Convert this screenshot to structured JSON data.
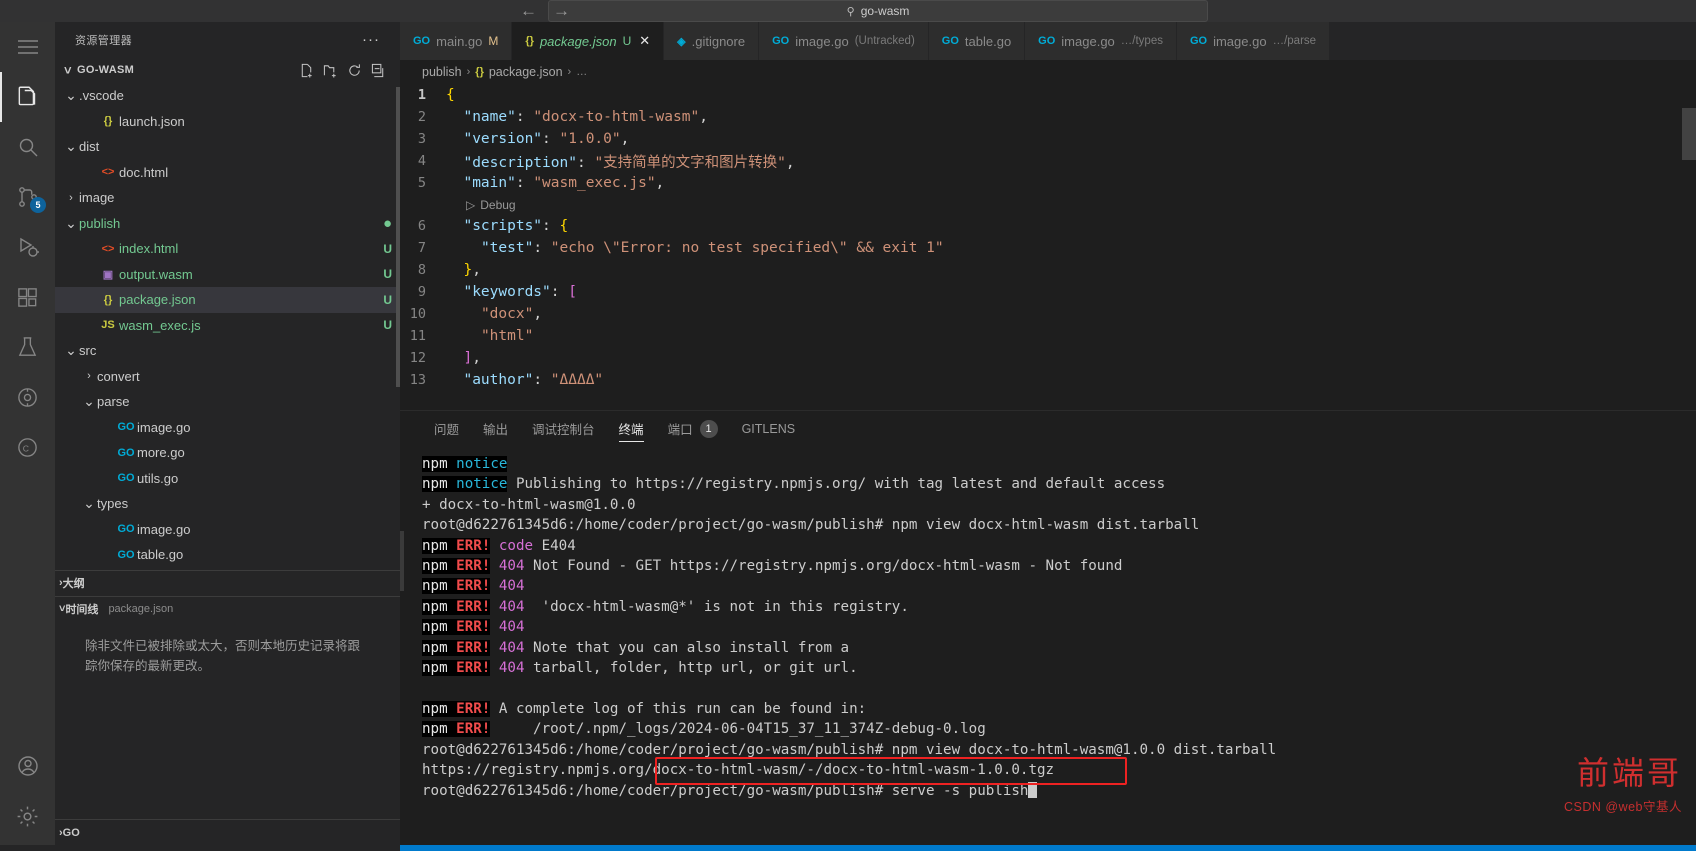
{
  "window": {
    "quick_open_value": "go-wasm",
    "search_icon": "search-icon",
    "back_arrow": "←",
    "forward_arrow": "→"
  },
  "activitybar": {
    "items": [
      {
        "name": "menu-hamburger-icon",
        "label": ""
      },
      {
        "name": "explorer-icon",
        "label": "",
        "active": true
      },
      {
        "name": "search-icon",
        "label": ""
      },
      {
        "name": "source-control-icon",
        "label": "",
        "badge": "5"
      },
      {
        "name": "run-debug-icon",
        "label": ""
      },
      {
        "name": "extensions-icon",
        "label": ""
      },
      {
        "name": "testing-icon",
        "label": ""
      },
      {
        "name": "gitlens-icon",
        "label": ""
      },
      {
        "name": "remote-explorer-icon",
        "label": ""
      }
    ],
    "bottom_items": [
      {
        "name": "accounts-icon",
        "label": ""
      },
      {
        "name": "settings-gear-icon",
        "label": ""
      }
    ]
  },
  "sidebar": {
    "title": "资源管理器",
    "more_actions": "···",
    "root": {
      "label": "GO-WASM",
      "actions": [
        "new-file-icon",
        "new-folder-icon",
        "refresh-icon",
        "collapse-all-icon"
      ]
    },
    "tree": [
      {
        "label": ".vscode",
        "indent": 1,
        "type": "folder",
        "expanded": true,
        "icon": "chevron-down",
        "color": "plain"
      },
      {
        "label": "launch.json",
        "indent": 2,
        "type": "file",
        "icon": "json",
        "color": "plain"
      },
      {
        "label": "dist",
        "indent": 1,
        "type": "folder",
        "expanded": true,
        "icon": "chevron-down",
        "color": "plain"
      },
      {
        "label": "doc.html",
        "indent": 2,
        "type": "file",
        "icon": "html",
        "color": "plain"
      },
      {
        "label": "image",
        "indent": 1,
        "type": "folder",
        "expanded": false,
        "icon": "chevron-right",
        "color": "plain"
      },
      {
        "label": "publish",
        "indent": 1,
        "type": "folder",
        "expanded": true,
        "icon": "chevron-down",
        "color": "green",
        "dot": true
      },
      {
        "label": "index.html",
        "indent": 2,
        "type": "file",
        "icon": "html",
        "color": "green",
        "status": "U"
      },
      {
        "label": "output.wasm",
        "indent": 2,
        "type": "file",
        "icon": "wasm",
        "color": "green",
        "status": "U"
      },
      {
        "label": "package.json",
        "indent": 2,
        "type": "file",
        "icon": "json",
        "color": "green",
        "status": "U",
        "selected": true
      },
      {
        "label": "wasm_exec.js",
        "indent": 2,
        "type": "file",
        "icon": "js",
        "color": "green",
        "status": "U"
      },
      {
        "label": "src",
        "indent": 1,
        "type": "folder",
        "expanded": true,
        "icon": "chevron-down",
        "color": "plain"
      },
      {
        "label": "convert",
        "indent": 2,
        "type": "folder",
        "expanded": false,
        "icon": "chevron-right",
        "color": "plain"
      },
      {
        "label": "parse",
        "indent": 2,
        "type": "folder",
        "expanded": true,
        "icon": "chevron-down",
        "color": "plain"
      },
      {
        "label": "image.go",
        "indent": 3,
        "type": "file",
        "icon": "go",
        "color": "plain"
      },
      {
        "label": "more.go",
        "indent": 3,
        "type": "file",
        "icon": "go",
        "color": "plain"
      },
      {
        "label": "utils.go",
        "indent": 3,
        "type": "file",
        "icon": "go",
        "color": "plain"
      },
      {
        "label": "types",
        "indent": 2,
        "type": "folder",
        "expanded": true,
        "icon": "chevron-down",
        "color": "plain"
      },
      {
        "label": "image.go",
        "indent": 3,
        "type": "file",
        "icon": "go",
        "color": "plain"
      },
      {
        "label": "table.go",
        "indent": 3,
        "type": "file",
        "icon": "go",
        "color": "plain"
      }
    ],
    "outline": {
      "label": "大纲",
      "expanded": false
    },
    "timeline": {
      "label": "时间线",
      "file": "package.json",
      "expanded": true,
      "message": "除非文件已被排除或太大，否则本地历史记录将跟踪你保存的最新更改。"
    },
    "go_section": {
      "label": "GO",
      "expanded": false
    }
  },
  "tabs": [
    {
      "name": "main.go",
      "icon": "go",
      "suffix": "",
      "status": "M",
      "active": false,
      "closable": false
    },
    {
      "name": "package.json",
      "icon": "json",
      "suffix": "",
      "status": "U",
      "active": true,
      "closable": true
    },
    {
      "name": ".gitignore",
      "icon": "git",
      "suffix": "",
      "status": "",
      "active": false,
      "closable": false
    },
    {
      "name": "image.go",
      "icon": "go",
      "suffix": "(Untracked)",
      "status": "",
      "active": false,
      "closable": false
    },
    {
      "name": "table.go",
      "icon": "go",
      "suffix": "",
      "status": "",
      "active": false,
      "closable": false
    },
    {
      "name": "image.go",
      "icon": "go",
      "suffix": "…/types",
      "status": "",
      "active": false,
      "closable": false
    },
    {
      "name": "image.go",
      "icon": "go",
      "suffix": "…/parse",
      "status": "",
      "active": false,
      "closable": false
    }
  ],
  "breadcrumb": {
    "items": [
      "publish",
      "package.json",
      "…"
    ],
    "separator": "›"
  },
  "editor": {
    "codelens": "Debug",
    "codelens_icon": "play-icon",
    "lines": [
      {
        "no": "1",
        "text": "{",
        "current": true
      },
      {
        "no": "2",
        "text": "  \"name\": \"docx-to-html-wasm\","
      },
      {
        "no": "3",
        "text": "  \"version\": \"1.0.0\","
      },
      {
        "no": "4",
        "text": "  \"description\": \"支持简单的文字和图片转换\","
      },
      {
        "no": "5",
        "text": "  \"main\": \"wasm_exec.js\","
      },
      {
        "no": "6",
        "text": "  \"scripts\": {"
      },
      {
        "no": "7",
        "text": "    \"test\": \"echo \\\"Error: no test specified\\\" && exit 1\""
      },
      {
        "no": "8",
        "text": "  },"
      },
      {
        "no": "9",
        "text": "  \"keywords\": ["
      },
      {
        "no": "10",
        "text": "    \"docx\","
      },
      {
        "no": "11",
        "text": "    \"html\""
      },
      {
        "no": "12",
        "text": "  ],"
      },
      {
        "no": "13",
        "text": "  \"author\": \"ΔΔΔΔ\""
      }
    ]
  },
  "panel": {
    "tabs": [
      {
        "label": "问题",
        "active": false
      },
      {
        "label": "输出",
        "active": false
      },
      {
        "label": "调试控制台",
        "active": false
      },
      {
        "label": "终端",
        "active": true
      },
      {
        "label": "端口",
        "active": false,
        "badge": "1"
      },
      {
        "label": "GITLENS",
        "active": false
      }
    ],
    "terminal_lines": [
      {
        "parts": [
          {
            "t": "npm ",
            "c": "npm"
          },
          {
            "t": "notice",
            "c": "notice"
          }
        ]
      },
      {
        "parts": [
          {
            "t": "npm ",
            "c": "npm"
          },
          {
            "t": "notice",
            "c": "notice"
          },
          {
            "t": " Publishing to https://registry.npmjs.org/ with tag latest and default access",
            "c": "white"
          }
        ]
      },
      {
        "parts": [
          {
            "t": "+ docx-to-html-wasm@1.0.0",
            "c": "white"
          }
        ]
      },
      {
        "parts": [
          {
            "t": "root@d622761345d6:/home/coder/project/go-wasm/publish# npm view docx-html-wasm dist.tarball",
            "c": "white"
          }
        ]
      },
      {
        "parts": [
          {
            "t": "npm ",
            "c": "npm"
          },
          {
            "t": "ERR!",
            "c": "err"
          },
          {
            "t": " ",
            "c": "white"
          },
          {
            "t": "code",
            "c": "code"
          },
          {
            "t": " E404",
            "c": "white"
          }
        ]
      },
      {
        "parts": [
          {
            "t": "npm ",
            "c": "npm"
          },
          {
            "t": "ERR!",
            "c": "err"
          },
          {
            "t": " ",
            "c": "white"
          },
          {
            "t": "404",
            "c": "code"
          },
          {
            "t": " Not Found - GET https://registry.npmjs.org/docx-html-wasm - Not found",
            "c": "white"
          }
        ]
      },
      {
        "parts": [
          {
            "t": "npm ",
            "c": "npm"
          },
          {
            "t": "ERR!",
            "c": "err"
          },
          {
            "t": " ",
            "c": "white"
          },
          {
            "t": "404",
            "c": "code"
          }
        ]
      },
      {
        "parts": [
          {
            "t": "npm ",
            "c": "npm"
          },
          {
            "t": "ERR!",
            "c": "err"
          },
          {
            "t": " ",
            "c": "white"
          },
          {
            "t": "404",
            "c": "code"
          },
          {
            "t": "  'docx-html-wasm@*' is not in this registry.",
            "c": "white"
          }
        ]
      },
      {
        "parts": [
          {
            "t": "npm ",
            "c": "npm"
          },
          {
            "t": "ERR!",
            "c": "err"
          },
          {
            "t": " ",
            "c": "white"
          },
          {
            "t": "404",
            "c": "code"
          }
        ]
      },
      {
        "parts": [
          {
            "t": "npm ",
            "c": "npm"
          },
          {
            "t": "ERR!",
            "c": "err"
          },
          {
            "t": " ",
            "c": "white"
          },
          {
            "t": "404",
            "c": "code"
          },
          {
            "t": " Note that you can also install from a",
            "c": "white"
          }
        ]
      },
      {
        "parts": [
          {
            "t": "npm ",
            "c": "npm"
          },
          {
            "t": "ERR!",
            "c": "err"
          },
          {
            "t": " ",
            "c": "white"
          },
          {
            "t": "404",
            "c": "code"
          },
          {
            "t": " tarball, folder, http url, or git url.",
            "c": "white"
          }
        ]
      },
      {
        "parts": []
      },
      {
        "parts": [
          {
            "t": "npm ",
            "c": "npm"
          },
          {
            "t": "ERR!",
            "c": "err"
          },
          {
            "t": " A complete log of this run can be found in:",
            "c": "white"
          }
        ]
      },
      {
        "parts": [
          {
            "t": "npm ",
            "c": "npm"
          },
          {
            "t": "ERR!",
            "c": "err"
          },
          {
            "t": "     /root/.npm/_logs/2024-06-04T15_37_11_374Z-debug-0.log",
            "c": "white"
          }
        ]
      },
      {
        "parts": [
          {
            "t": "root@d622761345d6:/home/coder/project/go-wasm/publish# npm view docx-to-html-wasm@1.0.0 dist.tarball",
            "c": "white"
          }
        ]
      },
      {
        "parts": [
          {
            "t": "https://registry.npmjs.org/docx-to-html-wasm/-/docx-to-html-wasm-1.0.0.tgz",
            "c": "white"
          }
        ]
      },
      {
        "parts": [
          {
            "t": "root@d622761345d6:/home/coder/project/go-wasm/publish# serve -s publish",
            "c": "white"
          }
        ],
        "cursor": true
      }
    ]
  },
  "annotation": {
    "redbox_label": "highlight-box"
  },
  "watermark": {
    "big": "前端哥",
    "small": "CSDN @web守基人"
  },
  "colors": {
    "accent": "#007acc",
    "green_untracked": "#73c991",
    "error_red": "#f14c4c",
    "annotation_red": "#ee2222",
    "editor_bg": "#1e1e1e",
    "sidebar_bg": "#252526",
    "activitybar_bg": "#333333"
  }
}
